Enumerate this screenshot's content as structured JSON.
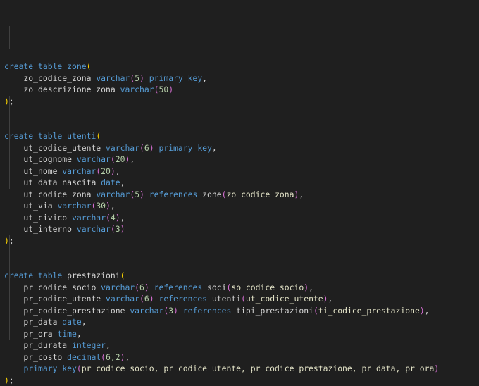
{
  "editor": {
    "background": "#1f1f1f",
    "lines": [
      [
        [
          "create table ",
          "kw"
        ],
        [
          "zone",
          "kw"
        ],
        [
          "(",
          "p1"
        ]
      ],
      [
        [
          "    zo_codice_zona ",
          "id"
        ],
        [
          "varchar",
          "kw"
        ],
        [
          "(",
          "p2"
        ],
        [
          "5",
          "num"
        ],
        [
          ")",
          "p2"
        ],
        [
          " primary key",
          "kw"
        ],
        [
          ",",
          "pn"
        ]
      ],
      [
        [
          "    zo_descrizione_zona ",
          "id"
        ],
        [
          "varchar",
          "kw"
        ],
        [
          "(",
          "p2"
        ],
        [
          "50",
          "num"
        ],
        [
          ")",
          "p2"
        ]
      ],
      [
        [
          ")",
          "p1"
        ],
        [
          ";",
          "pn"
        ]
      ],
      [],
      [],
      [
        [
          "create table ",
          "kw"
        ],
        [
          "utenti",
          "kw"
        ],
        [
          "(",
          "p1"
        ]
      ],
      [
        [
          "    ut_codice_utente ",
          "id"
        ],
        [
          "varchar",
          "kw"
        ],
        [
          "(",
          "p2"
        ],
        [
          "6",
          "num"
        ],
        [
          ")",
          "p2"
        ],
        [
          " primary key",
          "kw"
        ],
        [
          ",",
          "pn"
        ]
      ],
      [
        [
          "    ut_cognome ",
          "id"
        ],
        [
          "varchar",
          "kw"
        ],
        [
          "(",
          "p2"
        ],
        [
          "20",
          "num"
        ],
        [
          ")",
          "p2"
        ],
        [
          ",",
          "pn"
        ]
      ],
      [
        [
          "    ut_nome ",
          "id"
        ],
        [
          "varchar",
          "kw"
        ],
        [
          "(",
          "p2"
        ],
        [
          "20",
          "num"
        ],
        [
          ")",
          "p2"
        ],
        [
          ",",
          "pn"
        ]
      ],
      [
        [
          "    ut_data_nascita ",
          "id"
        ],
        [
          "date",
          "kw"
        ],
        [
          ",",
          "pn"
        ]
      ],
      [
        [
          "    ut_codice_zona ",
          "id"
        ],
        [
          "varchar",
          "kw"
        ],
        [
          "(",
          "p2"
        ],
        [
          "5",
          "num"
        ],
        [
          ")",
          "p2"
        ],
        [
          " references ",
          "kw"
        ],
        [
          "zone",
          "id"
        ],
        [
          "(",
          "p2"
        ],
        [
          "zo_codice_zona",
          "arg"
        ],
        [
          ")",
          "p2"
        ],
        [
          ",",
          "pn"
        ]
      ],
      [
        [
          "    ut_via ",
          "id"
        ],
        [
          "varchar",
          "kw"
        ],
        [
          "(",
          "p2"
        ],
        [
          "30",
          "num"
        ],
        [
          ")",
          "p2"
        ],
        [
          ",",
          "pn"
        ]
      ],
      [
        [
          "    ut_civico ",
          "id"
        ],
        [
          "varchar",
          "kw"
        ],
        [
          "(",
          "p2"
        ],
        [
          "4",
          "num"
        ],
        [
          ")",
          "p2"
        ],
        [
          ",",
          "pn"
        ]
      ],
      [
        [
          "    ut_interno ",
          "id"
        ],
        [
          "varchar",
          "kw"
        ],
        [
          "(",
          "p2"
        ],
        [
          "3",
          "num"
        ],
        [
          ")",
          "p2"
        ]
      ],
      [
        [
          ")",
          "p1"
        ],
        [
          ";",
          "pn"
        ]
      ],
      [],
      [],
      [
        [
          "create table ",
          "kw"
        ],
        [
          "prestazioni",
          "id"
        ],
        [
          "(",
          "p1"
        ]
      ],
      [
        [
          "    pr_codice_socio ",
          "id"
        ],
        [
          "varchar",
          "kw"
        ],
        [
          "(",
          "p2"
        ],
        [
          "6",
          "num"
        ],
        [
          ")",
          "p2"
        ],
        [
          " references ",
          "kw"
        ],
        [
          "soci",
          "id"
        ],
        [
          "(",
          "p2"
        ],
        [
          "so_codice_socio",
          "arg"
        ],
        [
          ")",
          "p2"
        ],
        [
          ",",
          "pn"
        ]
      ],
      [
        [
          "    pr_codice_utente ",
          "id"
        ],
        [
          "varchar",
          "kw"
        ],
        [
          "(",
          "p2"
        ],
        [
          "6",
          "num"
        ],
        [
          ")",
          "p2"
        ],
        [
          " references ",
          "kw"
        ],
        [
          "utenti",
          "id"
        ],
        [
          "(",
          "p2"
        ],
        [
          "ut_codice_utente",
          "arg"
        ],
        [
          ")",
          "p2"
        ],
        [
          ",",
          "pn"
        ]
      ],
      [
        [
          "    pr_codice_prestazione ",
          "id"
        ],
        [
          "varchar",
          "kw"
        ],
        [
          "(",
          "p2"
        ],
        [
          "3",
          "num"
        ],
        [
          ")",
          "p2"
        ],
        [
          " references ",
          "kw"
        ],
        [
          "tipi_prestazioni",
          "id"
        ],
        [
          "(",
          "p2"
        ],
        [
          "ti_codice_prestazione",
          "arg"
        ],
        [
          ")",
          "p2"
        ],
        [
          ",",
          "pn"
        ]
      ],
      [
        [
          "    pr_data ",
          "id"
        ],
        [
          "date",
          "kw"
        ],
        [
          ",",
          "pn"
        ]
      ],
      [
        [
          "    pr_ora ",
          "id"
        ],
        [
          "time",
          "kw"
        ],
        [
          ",",
          "pn"
        ]
      ],
      [
        [
          "    pr_durata ",
          "id"
        ],
        [
          "integer",
          "kw"
        ],
        [
          ",",
          "pn"
        ]
      ],
      [
        [
          "    pr_costo ",
          "id"
        ],
        [
          "decimal",
          "kw"
        ],
        [
          "(",
          "p2"
        ],
        [
          "6,2",
          "num"
        ],
        [
          ")",
          "p2"
        ],
        [
          ",",
          "pn"
        ]
      ],
      [
        [
          "    ",
          "id"
        ],
        [
          "primary key",
          "kw"
        ],
        [
          "(",
          "p2"
        ],
        [
          "pr_codice_socio, pr_codice_utente, pr_codice_prestazione, pr_data, pr_ora",
          "arg"
        ],
        [
          ")",
          "p2"
        ]
      ],
      [
        [
          ")",
          "p1"
        ],
        [
          ";",
          "pn"
        ]
      ]
    ]
  }
}
